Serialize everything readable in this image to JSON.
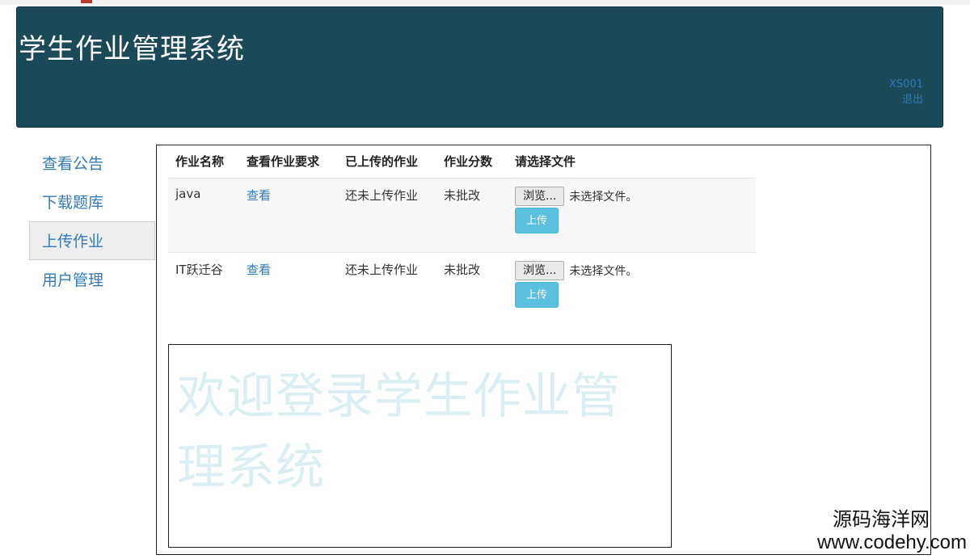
{
  "header": {
    "title": "学生作业管理系统",
    "user_id": "XS001",
    "logout_label": "退出",
    "background_color": "#1a4a58"
  },
  "sidebar": {
    "items": [
      {
        "label": "查看公告",
        "active": false
      },
      {
        "label": "下载题库",
        "active": false
      },
      {
        "label": "上传作业",
        "active": true
      },
      {
        "label": "用户管理",
        "active": false
      }
    ]
  },
  "table": {
    "columns": [
      "作业名称",
      "查看作业要求",
      "已上传的作业",
      "作业分数",
      "请选择文件"
    ],
    "rows": [
      {
        "name": "java",
        "view_label": "查看",
        "uploaded": "还未上传作业",
        "score": "未批改",
        "browse_label": "浏览...",
        "file_status": "未选择文件。",
        "upload_label": "上传"
      },
      {
        "name": "IT跃迁谷",
        "view_label": "查看",
        "uploaded": "还未上传作业",
        "score": "未批改",
        "browse_label": "浏览...",
        "file_status": "未选择文件。",
        "upload_label": "上传"
      }
    ]
  },
  "welcome": {
    "text": "欢迎登录学生作业管理系统"
  },
  "watermark": {
    "brand": "源码海洋网",
    "url": "www.codehy.com"
  }
}
